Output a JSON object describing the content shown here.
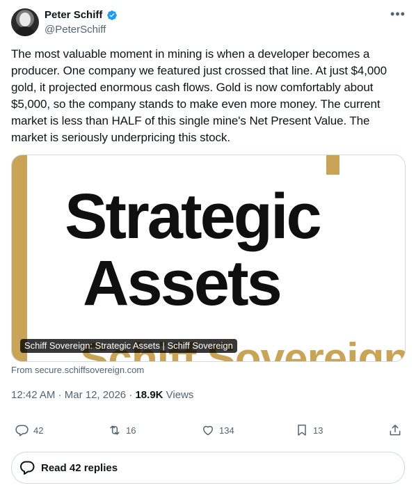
{
  "author": {
    "name": "Peter Schiff",
    "handle": "@PeterSchiff",
    "verified": true,
    "avatar_icon": "avatar-photo"
  },
  "tweet": {
    "text": "The most valuable moment in mining is when a developer becomes a producer. One company we featured just crossed that line. At just $4,000 gold, it projected enormous cash flows. Gold is now comfortably about $5,000, so the company stands to make even more money. The current market is less than HALF of this single mine's Net Present Value. The market is seriously underpricing this stock."
  },
  "card": {
    "headline_line1": "Strategic",
    "headline_line2": "Assets",
    "subheading": "Schiff Sovereign",
    "overlay_title": "Schiff Sovereign: Strategic Assets | Schiff Sovereign",
    "source": "From secure.schiffsovereign.com",
    "accent_color": "#c9a356"
  },
  "meta": {
    "time": "12:42 AM",
    "separator": "·",
    "date": "Mar 12, 2026",
    "views_count": "18.9K",
    "views_label": "Views"
  },
  "actions": {
    "replies": "42",
    "retweets": "16",
    "likes": "134",
    "bookmarks": "13"
  },
  "read_replies": {
    "label": "Read 42 replies"
  },
  "colors": {
    "text": "#0f1419",
    "secondary": "#536471",
    "verified": "#1d9bf0",
    "border": "#cfd9de"
  }
}
